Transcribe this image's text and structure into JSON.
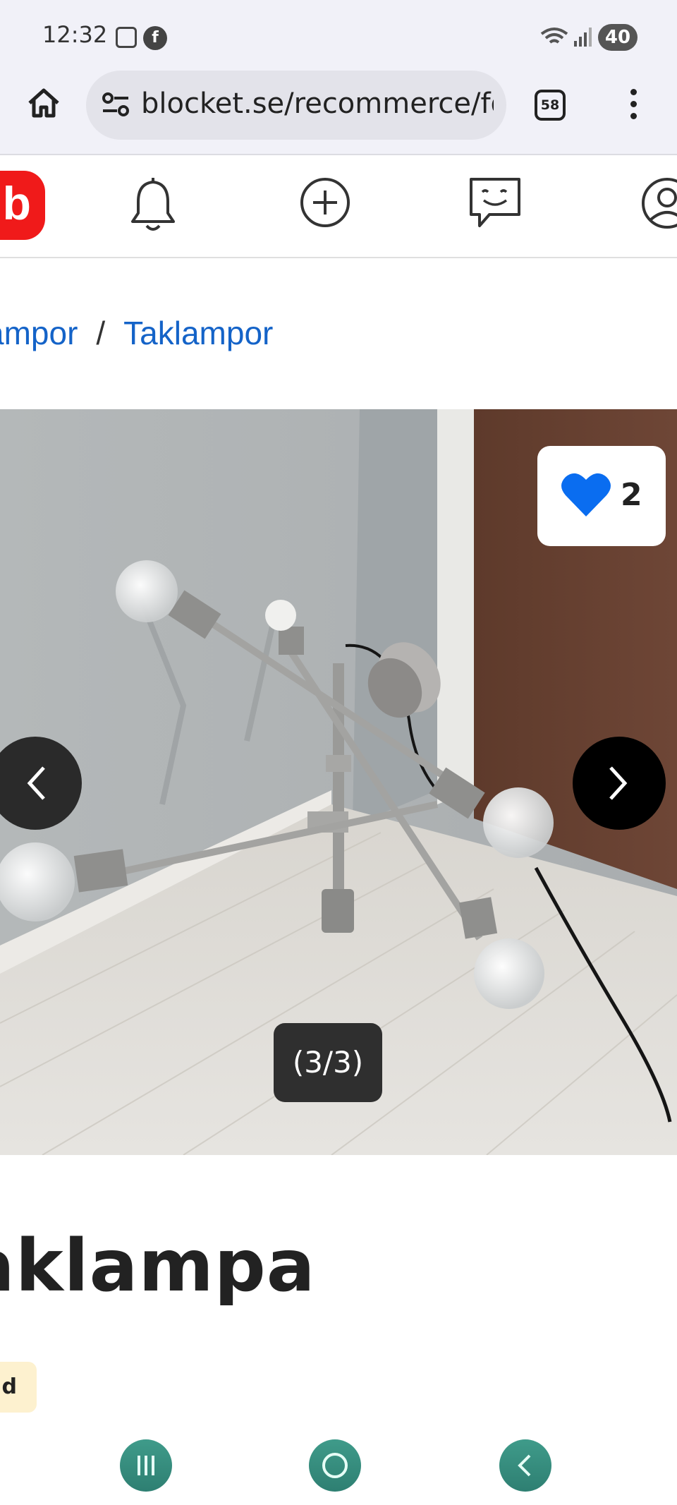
{
  "status_bar": {
    "time": "12:32",
    "fb_icon_letter": "f",
    "battery": "40"
  },
  "browser": {
    "url": "blocket.se/recommerce/forsaljning",
    "tab_count": "58"
  },
  "site": {
    "logo_letter": "b",
    "accent_color": "#f01a1a"
  },
  "breadcrumb": {
    "items": [
      "ampor",
      "Taklampor"
    ],
    "separator": "/"
  },
  "gallery": {
    "like_count": "2",
    "counter": "(3/3)"
  },
  "ad": {
    "title": "aklampa",
    "badge": "ld"
  },
  "icons": {
    "header": [
      "bell-icon",
      "plus-circle-icon",
      "chat-icon",
      "profile-icon"
    ],
    "system": [
      "recents-icon",
      "home-icon",
      "back-icon"
    ]
  }
}
